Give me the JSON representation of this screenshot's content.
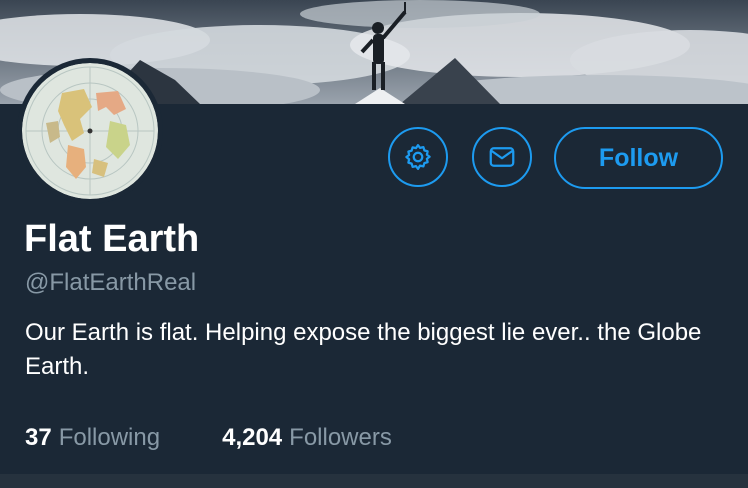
{
  "profile": {
    "name": "Flat Earth",
    "handle": "@FlatEarthReal",
    "bio": "Our Earth is flat. Helping expose the biggest lie ever.. the Globe Earth.",
    "follow_label": "Follow"
  },
  "stats": {
    "following_count": "37",
    "following_label": "Following",
    "followers_count": "4,204",
    "followers_label": "Followers"
  },
  "colors": {
    "background": "#1b2836",
    "accent": "#1d9bf0",
    "secondary_text": "#8899a6"
  },
  "icons": {
    "settings": "gear-icon",
    "message": "envelope-icon"
  }
}
